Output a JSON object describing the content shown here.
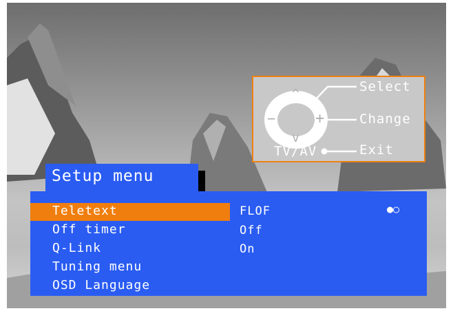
{
  "guide": {
    "select_label": "Select",
    "change_label": "Change",
    "exit_label": "Exit",
    "tvav_label": "TV/AV",
    "up_glyph": "^",
    "down_glyph": "v",
    "minus_glyph": "−",
    "plus_glyph": "+"
  },
  "menu": {
    "title": "Setup menu",
    "items": [
      {
        "label": "Teletext",
        "value": "FLOF",
        "selected": true
      },
      {
        "label": "Off timer",
        "value": "Off",
        "selected": false
      },
      {
        "label": "Q-Link",
        "value": "On",
        "selected": false
      },
      {
        "label": "Tuning menu",
        "value": "",
        "selected": false
      },
      {
        "label": "OSD Language",
        "value": "",
        "selected": false
      }
    ],
    "page_indicator": "●○"
  },
  "colors": {
    "menu_blue": "#2a5cf2",
    "highlight_orange": "#f07e0e",
    "guide_border": "#f08010",
    "guide_bg": "#c8c8c8"
  }
}
